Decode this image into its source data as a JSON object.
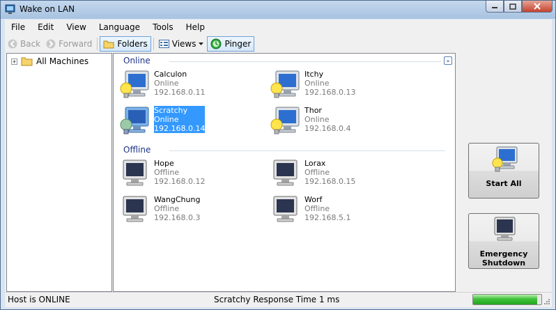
{
  "window": {
    "title": "Wake on LAN"
  },
  "menu": [
    "File",
    "Edit",
    "View",
    "Language",
    "Tools",
    "Help"
  ],
  "toolbar": {
    "back": "Back",
    "forward": "Forward",
    "folders": "Folders",
    "views": "Views",
    "pinger": "Pinger"
  },
  "tree": {
    "root": "All Machines"
  },
  "groups": {
    "online": {
      "header": "Online",
      "machines": [
        {
          "name": "Calculon",
          "status": "Online",
          "ip": "192.168.0.11"
        },
        {
          "name": "Itchy",
          "status": "Online",
          "ip": "192.168.0.13"
        },
        {
          "name": "Scratchy",
          "status": "Online",
          "ip": "192.168.0.14"
        },
        {
          "name": "Thor",
          "status": "Online",
          "ip": "192.168.0.4"
        }
      ]
    },
    "offline": {
      "header": "Offline",
      "machines": [
        {
          "name": "Hope",
          "status": "Offline",
          "ip": "192.168.0.12"
        },
        {
          "name": "Lorax",
          "status": "Offline",
          "ip": "192.168.0.15"
        },
        {
          "name": "WangChung",
          "status": "Offline",
          "ip": "192.168.0.3"
        },
        {
          "name": "Worf",
          "status": "Offline",
          "ip": "192.168.5.1"
        }
      ]
    }
  },
  "actions": {
    "start_all": "Start All",
    "emergency_line1": "Emergency",
    "emergency_line2": "Shutdown"
  },
  "status": {
    "left": "Host is ONLINE",
    "middle": "Scratchy Response Time 1 ms",
    "progress": 0.94
  },
  "colors": {
    "selection": "#3399ff",
    "group_header": "#1e3287",
    "progress": "#3ec13a"
  }
}
